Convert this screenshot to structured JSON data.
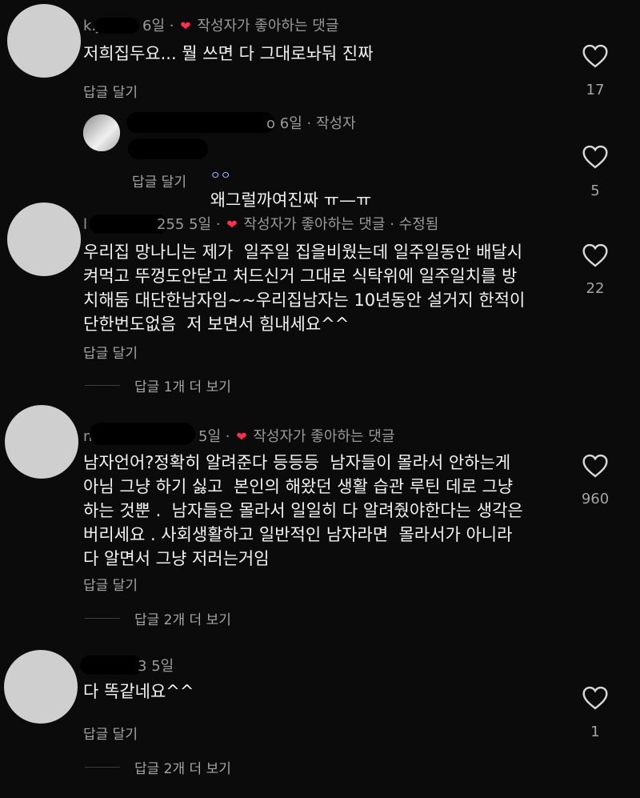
{
  "comments": [
    {
      "name_visible": "k.j",
      "time": "6일",
      "author_liked": "작성자가 좋아하는 댓글",
      "text": "저희집두요... 뭘 쓰면 다 그대로놔둬 진짜",
      "reply_label": "답글 달기",
      "likes": "17"
    },
    {
      "name_visible": "o",
      "time": "6일",
      "author_tag": "작성자",
      "text": "왜그럴까여진짜 ㅠ—ㅠ",
      "mention_visible": "ㅇㅇ",
      "reply_label": "답글 달기",
      "likes": "5"
    },
    {
      "name_visible": "l",
      "name_tail": "255",
      "time": "5일",
      "author_liked": "작성자가 좋아하는 댓글",
      "edited": "수정됨",
      "lines": [
        "우리집 망나니는 제가  일주일 집을비웠는데 일주일동안 배달시",
        "켜먹고 뚜껑도안닫고 처드신거 그대로 식탁위에 일주일치를 방",
        "치해둠 대단한남자임~~우리집남자는 10년동안 설거지 한적이",
        "단한번도없음  저 보면서 힘내세요^^"
      ],
      "reply_label": "답글 달기",
      "likes": "22",
      "more_replies": "답글 1개 더 보기"
    },
    {
      "name_visible": "n",
      "time": "5일",
      "author_liked": "작성자가 좋아하는 댓글",
      "lines": [
        "남자언어?정확히 알려준다 등등등  남자들이 몰라서 안하는게",
        "아님 그냥 하기 싫고  본인의 해왔던 생활 습관 루틴 데로 그냥",
        "하는 것뿐 .  남자들은 몰라서 일일히 다 알려줬야한다는 생각은",
        "버리세요 . 사회생활하고 일반적인 남자라면  몰라서가 아니라",
        "다 알면서 그냥 저러는거임"
      ],
      "reply_label": "답글 달기",
      "likes": "960",
      "more_replies": "답글 2개 더 보기"
    },
    {
      "name_tail": "3",
      "time": "5일",
      "text": "다 똑같네요^^",
      "reply_label": "답글 달기",
      "likes": "1",
      "more_replies": "답글 2개 더 보기"
    }
  ],
  "colors": {
    "background": "#0b0b0b",
    "heart_badge": "#ff2d4f",
    "meta_text": "#9a9a9a"
  },
  "icons": {
    "like": "heart-outline-icon",
    "author_liked": "heart-filled-icon"
  }
}
